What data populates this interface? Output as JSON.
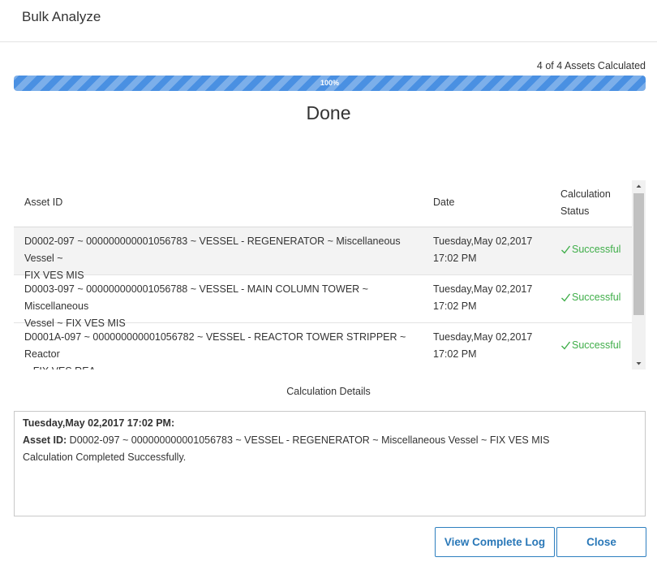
{
  "dialog": {
    "title": "Bulk Analyze",
    "assets_calculated": "4 of 4 Assets Calculated",
    "progress": {
      "percent": 100,
      "label": "100%"
    },
    "status_text": "Done"
  },
  "table": {
    "headers": {
      "asset_id": "Asset ID",
      "date": "Date",
      "status_line1": "Calculation",
      "status_line2": "Status"
    },
    "rows": [
      {
        "asset_line1": "D0002-097 ~ 000000000001056783 ~ VESSEL - REGENERATOR ~ Miscellaneous Vessel ~",
        "asset_line2": "FIX VES MIS",
        "date_line1": "Tuesday,May 02,2017",
        "date_line2": "17:02 PM",
        "status": "Successful"
      },
      {
        "asset_line1": "D0003-097 ~ 000000000001056788 ~ VESSEL - MAIN COLUMN TOWER ~ Miscellaneous",
        "asset_line2": "Vessel ~ FIX VES MIS",
        "date_line1": "Tuesday,May 02,2017",
        "date_line2": "17:02 PM",
        "status": "Successful"
      },
      {
        "asset_line1": "D0001A-097 ~ 000000000001056782 ~ VESSEL - REACTOR TOWER STRIPPER ~ Reactor",
        "asset_line2": "~ FIX VES REA",
        "date_line1": "Tuesday,May 02,2017",
        "date_line2": "17:02 PM",
        "status": "Successful"
      }
    ]
  },
  "details": {
    "heading": "Calculation Details",
    "timestamp": "Tuesday,May 02,2017 17:02 PM:",
    "asset_label": "Asset ID:",
    "asset_value": "D0002-097 ~ 000000000001056783 ~ VESSEL - REGENERATOR ~ Miscellaneous Vessel ~ FIX VES MIS",
    "result": "Calculation Completed Successfully."
  },
  "buttons": {
    "view_log": "View Complete Log",
    "close": "Close"
  },
  "colors": {
    "progress": "#4a90e2",
    "success": "#3fae49",
    "button_accent": "#2a78b8"
  },
  "icons": {
    "status": "check-icon",
    "scroll_up": "scroll-up-arrow-icon",
    "scroll_down": "scroll-down-arrow-icon"
  }
}
